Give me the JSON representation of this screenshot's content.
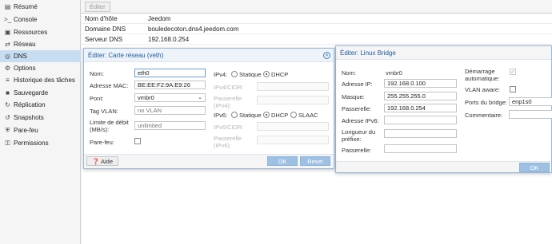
{
  "sidebar": {
    "items": [
      {
        "label": "Résumé",
        "icon": "book-icon",
        "glyph": "▤"
      },
      {
        "label": "Console",
        "icon": "terminal-icon",
        "glyph": ">_"
      },
      {
        "label": "Ressources",
        "icon": "cube-icon",
        "glyph": "▣"
      },
      {
        "label": "Réseau",
        "icon": "network-icon",
        "glyph": "⇄"
      },
      {
        "label": "DNS",
        "icon": "globe-icon",
        "glyph": "◎"
      },
      {
        "label": "Options",
        "icon": "gear-icon",
        "glyph": "⚙"
      },
      {
        "label": "Historique des tâches",
        "icon": "list-icon",
        "glyph": "≡"
      },
      {
        "label": "Sauvegarde",
        "icon": "floppy-icon",
        "glyph": "■"
      },
      {
        "label": "Réplication",
        "icon": "retweet-icon",
        "glyph": "↻"
      },
      {
        "label": "Snapshots",
        "icon": "history-icon",
        "glyph": "↺"
      },
      {
        "label": "Pare-feu",
        "icon": "shield-icon",
        "glyph": "⛨"
      },
      {
        "label": "Permissions",
        "icon": "unlock-icon",
        "glyph": "⚿"
      }
    ],
    "selected": "DNS"
  },
  "toolbar": {
    "edit_label": "Éditer"
  },
  "dns_info": [
    {
      "key": "Nom d'hôte",
      "value": "Jeedom"
    },
    {
      "key": "Domaine DNS",
      "value": "bouledecoton.dns4.jeedom.com"
    },
    {
      "key": "Serveur DNS",
      "value": "192.168.0.254"
    }
  ],
  "veth_dialog": {
    "title": "Éditer: Carte réseau (veth)",
    "name_label": "Nom:",
    "name_value": "eth0",
    "mac_label": "Adresse MAC:",
    "mac_value": "BE:EE:F2:9A:E9:26",
    "bridge_label": "Pont:",
    "bridge_value": "vmbr0",
    "vlan_label": "Tag VLAN:",
    "vlan_value": "no VLAN",
    "rate_label": "Limite de débit (MB/s):",
    "rate_value": "unlimited",
    "firewall_label": "Pare-feu:",
    "ipv4_label": "IPv4:",
    "ipv4_static": "Statique",
    "ipv4_dhcp": "DHCP",
    "ipv4_cidr_label": "IPv4/CIDR:",
    "gw4_label": "Passerelle (IPv4):",
    "ipv6_label": "IPv6:",
    "ipv6_static": "Statique",
    "ipv6_dhcp": "DHCP",
    "ipv6_slaac": "SLAAC",
    "ipv6_cidr_label": "IPv6/CIDR:",
    "gw6_label": "Passerelle (IPv6):",
    "help_label": "Aide",
    "ok_label": "OK",
    "reset_label": "Reset"
  },
  "bridge_dialog": {
    "title": "Éditer: Linux Bridge",
    "name_label": "Nom:",
    "name_value": "vmbr0",
    "ip_label": "Adresse IP:",
    "ip_value": "192.168.0.100",
    "mask_label": "Masque:",
    "mask_value": "255.255.255.0",
    "gw_label": "Passerelle:",
    "gw_value": "192.168.0.254",
    "ipv6_label": "Adresse IPv6:",
    "prefix_label": "Longueur du préfixe:",
    "gw6_label": "Passerelle:",
    "autostart_label": "Démarrage automatique:",
    "vlan_aware_label": "VLAN aware:",
    "ports_label": "Ports du bridge:",
    "ports_value": "enp1s0",
    "comment_label": "Commentaire:",
    "ok_label": "OK"
  }
}
